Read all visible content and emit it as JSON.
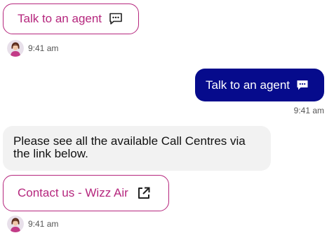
{
  "quick_reply": {
    "label": "Talk to an agent",
    "icon": "chat-bubble-icon"
  },
  "messages": [
    {
      "sender": "agent",
      "time": "9:41 am"
    },
    {
      "sender": "user",
      "text": "Talk to an agent",
      "icon": "chat-bubble-icon",
      "time": "9:41 am"
    },
    {
      "sender": "agent",
      "text": "Please see all the available Call Centres via the link below."
    },
    {
      "sender": "agent",
      "time": "9:41 am"
    }
  ],
  "link_button": {
    "label": "Contact us - Wizz Air",
    "icon": "external-link-icon"
  },
  "colors": {
    "accent": "#b5267d",
    "user_bubble": "#060b8c",
    "agent_bubble": "#f2f2f2",
    "timestamp": "#555555"
  }
}
